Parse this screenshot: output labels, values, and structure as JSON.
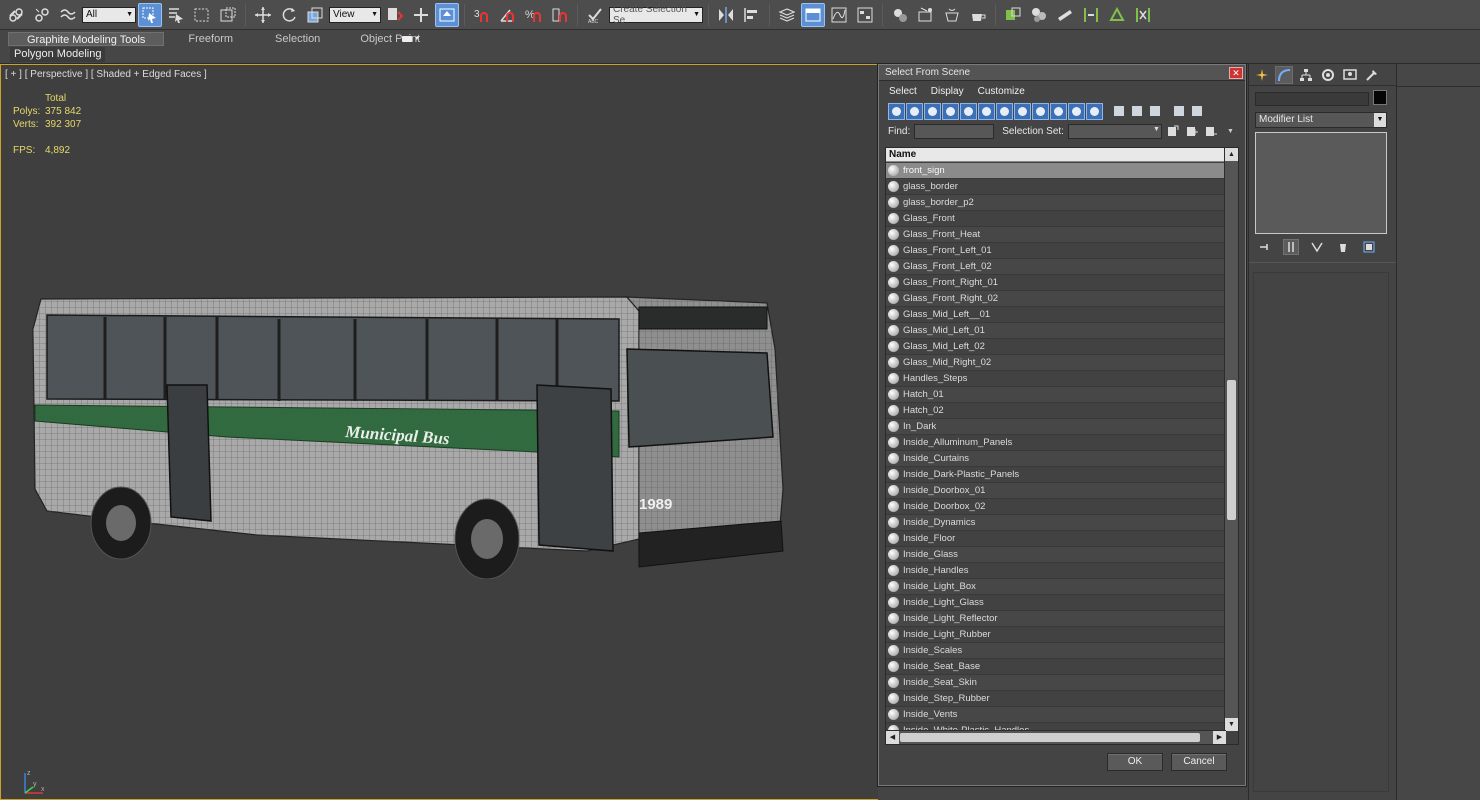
{
  "toolbar": {
    "filter_combo": "All",
    "refcoord_combo": "View",
    "named_selection": "Create Selection Se"
  },
  "ribbon": {
    "tabs": [
      "Graphite Modeling Tools",
      "Freeform",
      "Selection",
      "Object Paint"
    ],
    "active_tab": 0,
    "panel_label": "Polygon Modeling"
  },
  "viewport": {
    "label": "[ + ] [ Perspective ] [ Shaded + Edged Faces ]",
    "stats": {
      "total_label": "Total",
      "polys_label": "Polys:",
      "polys_value": "375 842",
      "verts_label": "Verts:",
      "verts_value": "392 307",
      "fps_label": "FPS:",
      "fps_value": "4,892"
    },
    "bus": {
      "side_text": "Municipal Bus",
      "number": "1989"
    },
    "axis": {
      "x": "x",
      "y": "y",
      "z": "z"
    }
  },
  "dialog": {
    "title": "Select From Scene",
    "close_label": "✕",
    "menu": [
      "Select",
      "Display",
      "Customize"
    ],
    "find_label": "Find:",
    "find_value": "",
    "selset_label": "Selection Set:",
    "selset_value": "",
    "column_name": "Name",
    "items": [
      "front_sign",
      "glass_border",
      "glass_border_p2",
      "Glass_Front",
      "Glass_Front_Heat",
      "Glass_Front_Left_01",
      "Glass_Front_Left_02",
      "Glass_Front_Right_01",
      "Glass_Front_Right_02",
      "Glass_Mid_Left__01",
      "Glass_Mid_Left_01",
      "Glass_Mid_Left_02",
      "Glass_Mid_Right_02",
      "Handles_Steps",
      "Hatch_01",
      "Hatch_02",
      "In_Dark",
      "Inside_Alluminum_Panels",
      "Inside_Curtains",
      "Inside_Dark-Plastic_Panels",
      "Inside_Doorbox_01",
      "Inside_Doorbox_02",
      "Inside_Dynamics",
      "Inside_Floor",
      "Inside_Glass",
      "Inside_Handles",
      "Inside_Light_Box",
      "Inside_Light_Glass",
      "Inside_Light_Reflector",
      "Inside_Light_Rubber",
      "Inside_Scales",
      "Inside_Seat_Base",
      "Inside_Seat_Skin",
      "Inside_Step_Rubber",
      "Inside_Vents",
      "Inside_White-Plastic_Handles"
    ],
    "selected_index": 0,
    "ok_label": "OK",
    "cancel_label": "Cancel"
  },
  "command_panel": {
    "modifier_list": "Modifier List",
    "object_name": "",
    "object_color": "#050505"
  },
  "colors": {
    "accent": "#5b8fd6",
    "viewport_border": "#c9a227",
    "stats_text": "#e6d96a",
    "bus_stripe": "#2f6b3e"
  }
}
